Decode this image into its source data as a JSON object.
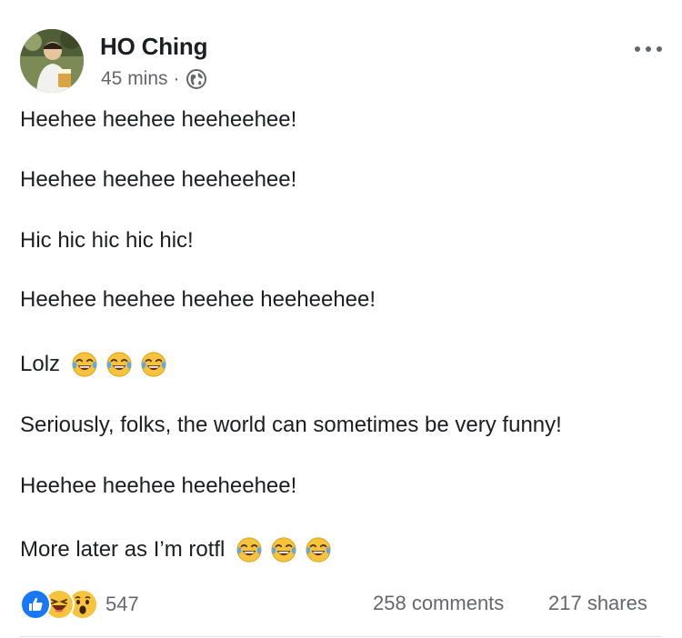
{
  "post": {
    "author": "HO Ching",
    "timestamp": "45 mins",
    "separator": "·",
    "privacy_icon": "globe-icon",
    "more_icon": "more-options-icon",
    "lines": [
      "Heehee heehee heeheehee!",
      "Heehee heehee heeheehee!",
      "Hic hic hic hic hic!",
      "Heehee heehee heehee heeheehee!",
      "Lolz",
      "Seriously, folks, the world can sometimes be very funny!",
      "Heehee heehee heeheehee!",
      "More later as I’m rotfl"
    ],
    "emoji_name": "face-with-tears-of-joy-emoji"
  },
  "footer": {
    "reaction_icons": [
      "like-reaction-icon",
      "haha-reaction-icon",
      "wow-reaction-icon"
    ],
    "reaction_count": "547",
    "comments": "258 comments",
    "shares": "217 shares"
  },
  "colors": {
    "text": "#1c1e21",
    "secondary": "#65676b",
    "like_blue": "#1877f2",
    "emoji_yellow": "#f7c33c",
    "tears_blue": "#5aa9f0"
  }
}
